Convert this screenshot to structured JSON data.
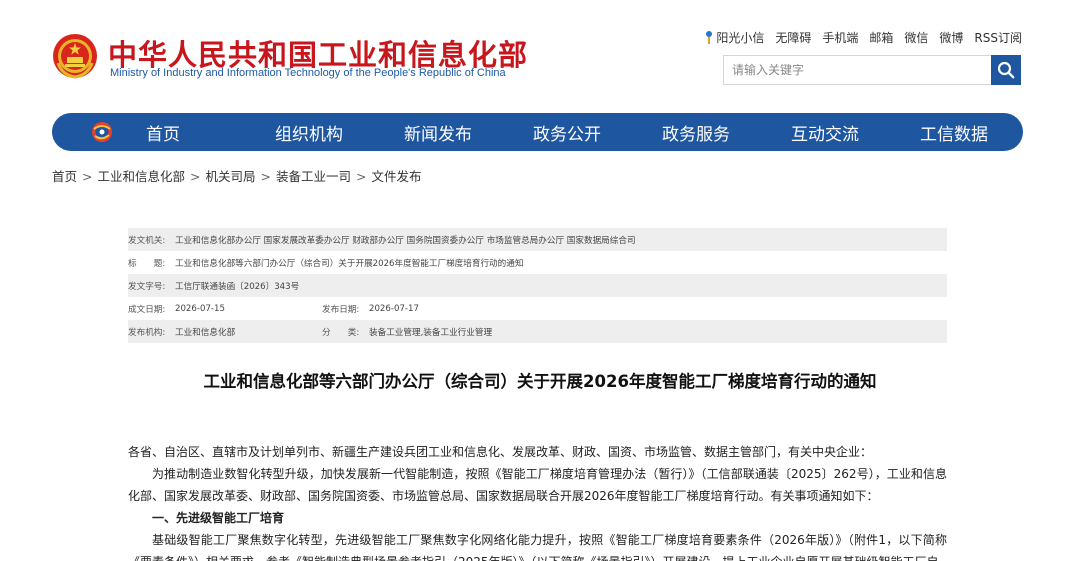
{
  "site": {
    "title": "中华人民共和国工业和信息化部",
    "subtitle": "Ministry of Industry and Information Technology of the People's Republic of China"
  },
  "toplinks": [
    "阳光小信",
    "无障碍",
    "手机端",
    "邮箱",
    "微信",
    "微博",
    "RSS订阅"
  ],
  "search": {
    "placeholder": "请输入关键字"
  },
  "nav": [
    "首页",
    "组织机构",
    "新闻发布",
    "政务公开",
    "政务服务",
    "互动交流",
    "工信数据"
  ],
  "breadcrumb": [
    "首页",
    "工业和信息化部",
    "机关司局",
    "装备工业一司",
    "文件发布"
  ],
  "meta": {
    "issuer_label": "发文机关:",
    "issuer": "工业和信息化部办公厅 国家发展改革委办公厅 财政部办公厅 国务院国资委办公厅 市场监管总局办公厅 国家数据局综合司",
    "title_label": "标　　题:",
    "title": "工业和信息化部等六部门办公厅（综合司）关于开展2026年度智能工厂梯度培育行动的通知",
    "docno_label": "发文字号:",
    "docno": "工信厅联通装函〔2026〕343号",
    "created_label": "成文日期:",
    "created": "2026-07-15",
    "published_label": "发布日期:",
    "published": "2026-07-17",
    "org_label": "发布机构:",
    "org": "工业和信息化部",
    "category_label": "分　　类:",
    "category": "装备工业管理,装备工业行业管理"
  },
  "document": {
    "title": "工业和信息化部等六部门办公厅（综合司）关于开展2026年度智能工厂梯度培育行动的通知",
    "salutation": "各省、自治区、直辖市及计划单列市、新疆生产建设兵团工业和信息化、发展改革、财政、国资、市场监管、数据主管部门，有关中央企业：",
    "para1": "为推动制造业数智化转型升级，加快发展新一代智能制造，按照《智能工厂梯度培育管理办法（暂行）》（工信部联通装〔2025〕262号），工业和信息化部、国家发展改革委、财政部、国务院国资委、市场监管总局、国家数据局联合开展2026年度智能工厂梯度培育行动。有关事项通知如下：",
    "heading1": "一、先进级智能工厂培育",
    "para2": "基础级智能工厂聚焦数字化转型，先进级智能工厂聚焦数字化网络化能力提升，按照《智能工厂梯度培育要素条件（2026年版）》（附件1，以下简称《要素条件》）相关要求，参考《智能制造典型场景参考指引（2025年版）》（以下简称《场景指引》）开展建设。提上工业企业自愿开展基础级智能工厂自"
  },
  "colors": {
    "brand_red": "#c8161d",
    "brand_blue": "#1e56a0"
  }
}
